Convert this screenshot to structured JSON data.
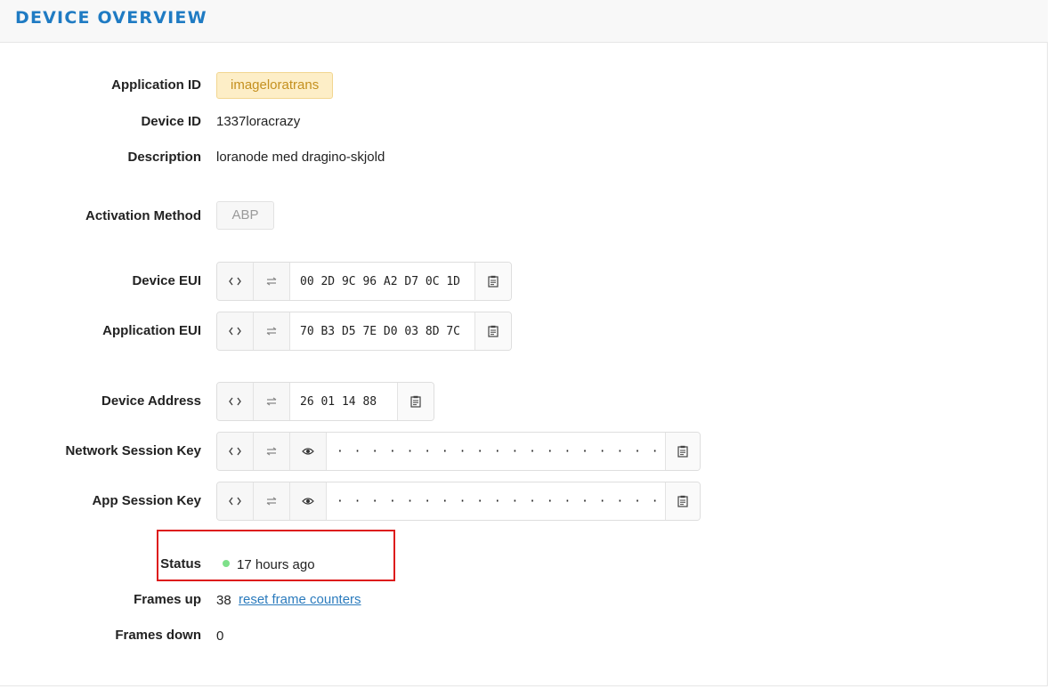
{
  "header": {
    "title": "DEVICE OVERVIEW"
  },
  "fields": {
    "application_id": {
      "label": "Application ID",
      "value": "imageloratrans"
    },
    "device_id": {
      "label": "Device ID",
      "value": "1337loracrazy"
    },
    "description": {
      "label": "Description",
      "value": "loranode med dragino-skjold"
    },
    "activation_method": {
      "label": "Activation Method",
      "value": "ABP"
    },
    "device_eui": {
      "label": "Device EUI",
      "value": "00 2D 9C 96 A2 D7 0C 1D"
    },
    "application_eui": {
      "label": "Application EUI",
      "value": "70 B3 D5 7E D0 03 8D 7C"
    },
    "device_address": {
      "label": "Device Address",
      "value": "26 01 14 88"
    },
    "network_session_key": {
      "label": "Network Session Key",
      "value": "· · · · · · · · · · · · · · · · · · · · · · · · · · · · · · · ·"
    },
    "app_session_key": {
      "label": "App Session Key",
      "value": "· · · · · · · · · · · · · · · · · · · · · · · · · · · · · · · ·"
    },
    "status": {
      "label": "Status",
      "value": "17 hours ago",
      "indicator_color": "#7ee08a"
    },
    "frames_up": {
      "label": "Frames up",
      "value": "38",
      "reset_link": "reset frame counters"
    },
    "frames_down": {
      "label": "Frames down",
      "value": "0"
    }
  },
  "icons": {
    "format": "code-brackets-icon",
    "byte_order": "swap-arrows-icon",
    "reveal": "eye-icon",
    "copy": "clipboard-icon"
  },
  "colors": {
    "title": "#1f7bc3",
    "badge_bg": "#fdeec7",
    "badge_text": "#c4901f",
    "link": "#2b7bbd",
    "highlight": "#dd1c1c"
  }
}
